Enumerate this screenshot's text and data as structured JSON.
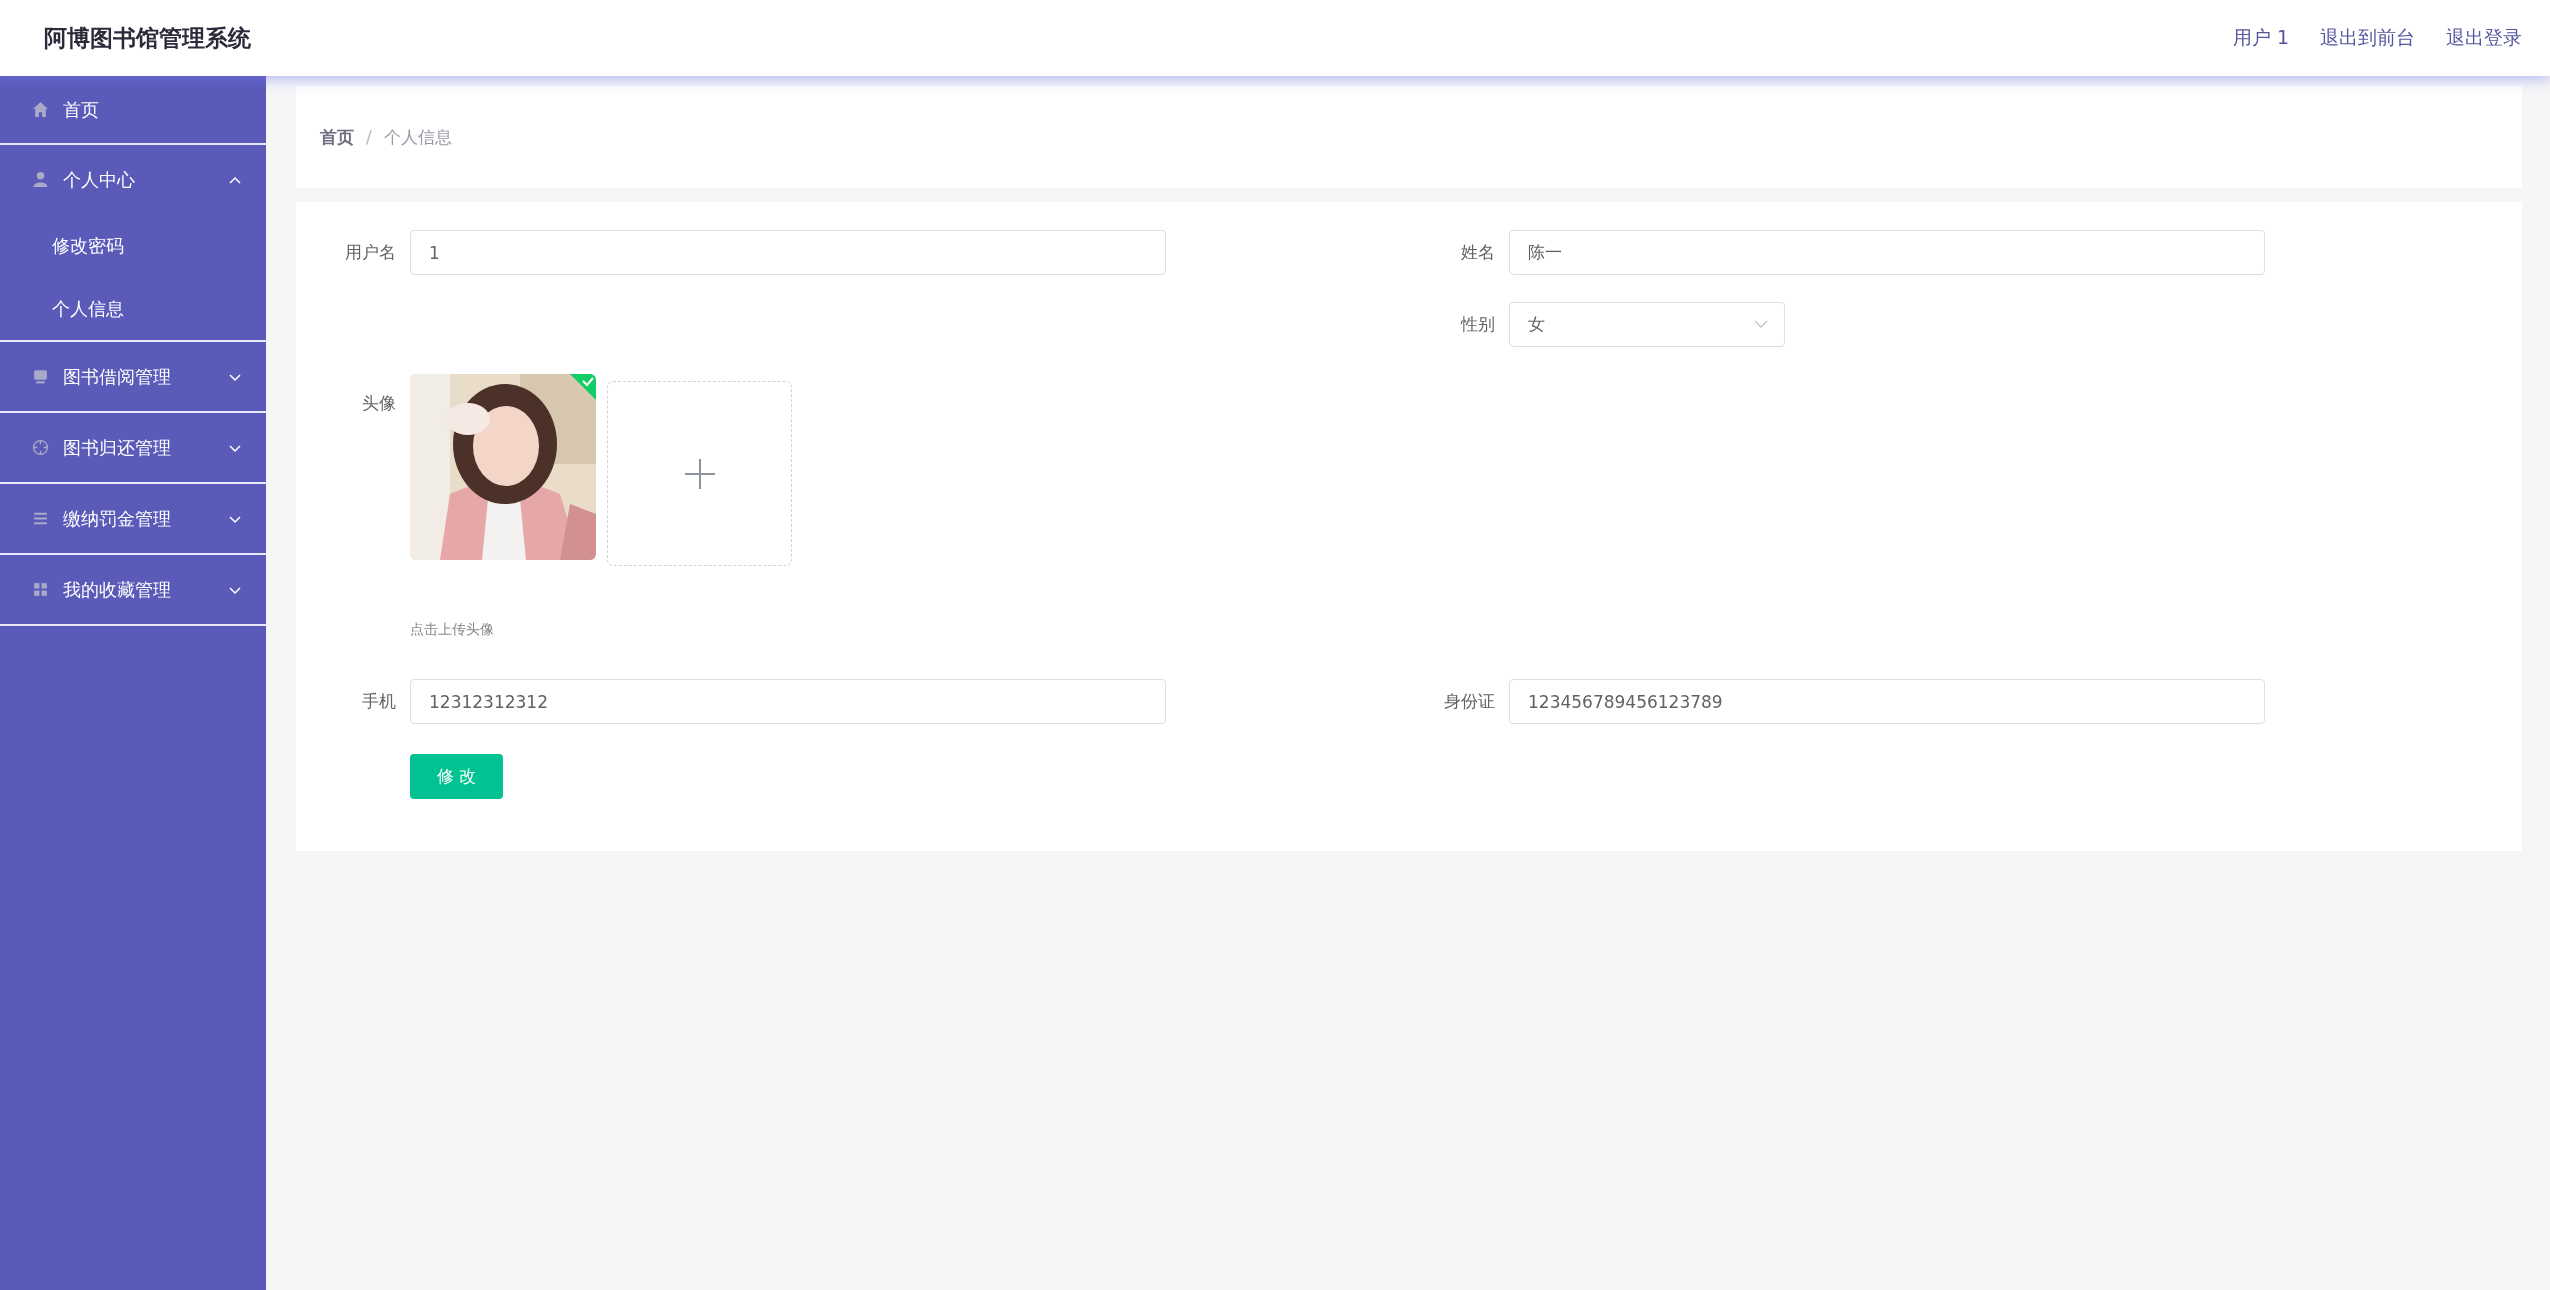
{
  "header": {
    "title": "阿博图书馆管理系统",
    "links": [
      "用户 1",
      "退出到前台",
      "退出登录"
    ]
  },
  "sidebar": {
    "items": [
      {
        "label": "首页",
        "kind": "link"
      },
      {
        "label": "个人中心",
        "kind": "group",
        "expanded": true,
        "children": [
          {
            "label": "修改密码"
          },
          {
            "label": "个人信息"
          }
        ]
      },
      {
        "label": "图书借阅管理",
        "kind": "group",
        "expanded": false
      },
      {
        "label": "图书归还管理",
        "kind": "group",
        "expanded": false
      },
      {
        "label": "缴纳罚金管理",
        "kind": "group",
        "expanded": false
      },
      {
        "label": "我的收藏管理",
        "kind": "group",
        "expanded": false
      }
    ]
  },
  "breadcrumb": {
    "separator": "/",
    "items": [
      {
        "label": "首页",
        "current": false
      },
      {
        "label": "个人信息",
        "current": true
      }
    ]
  },
  "form": {
    "rows": [
      {
        "left": {
          "label": "用户名",
          "kind": "text",
          "value": "1"
        },
        "right": {
          "label": "姓名",
          "kind": "text",
          "value": "陈一"
        }
      },
      {
        "right": {
          "label": "性别",
          "kind": "select",
          "value": "女"
        }
      },
      {
        "left": {
          "label": "头像",
          "kind": "upload",
          "uploaded": true,
          "hint": "点击上传头像"
        }
      },
      {
        "left": {
          "label": "手机",
          "kind": "text",
          "value": "12312312312"
        },
        "right": {
          "label": "身份证",
          "kind": "text",
          "value": "123456789456123789"
        }
      }
    ],
    "submit": "修 改"
  }
}
